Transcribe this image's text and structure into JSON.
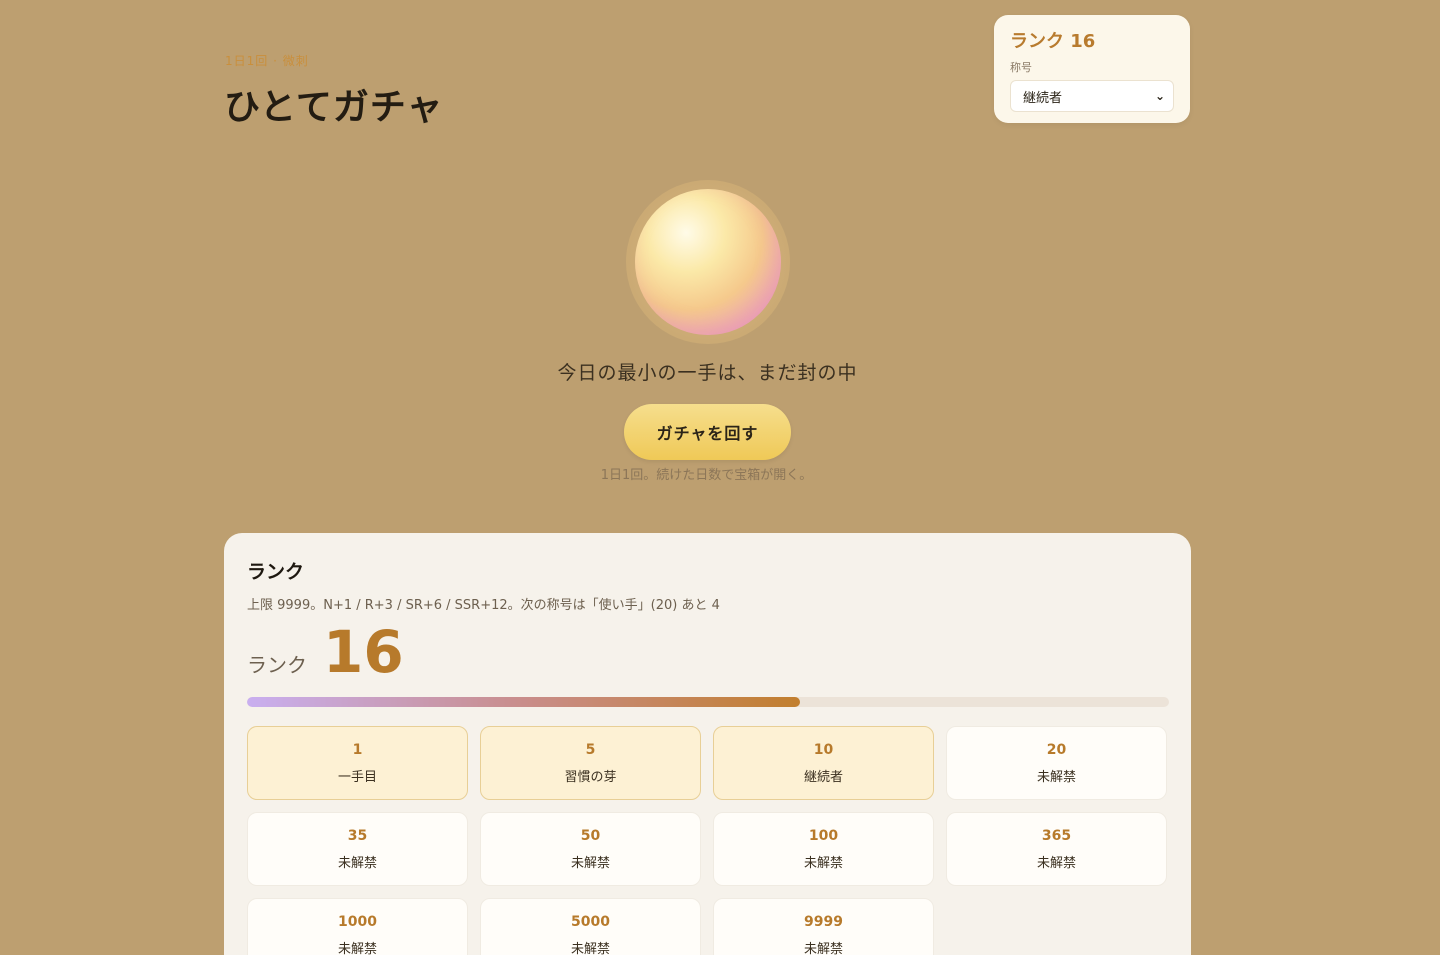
{
  "header": {
    "eyebrow": "1日1回 · 微刺",
    "title": "ひとてガチャ"
  },
  "rank_card": {
    "rank_title": "ランク 16",
    "title_label": "称号",
    "selected_title": "継続者"
  },
  "gacha": {
    "sealed_text": "今日の最小の一手は、まだ封の中",
    "spin_label": "ガチャを回す",
    "hint": "1日1回。続けた日数で宝箱が開く。"
  },
  "rank_panel": {
    "heading": "ランク",
    "description": "上限 9999。N+1 / R+3 / SR+6 / SSR+12。次の称号は「使い手」(20) あと 4",
    "rank_label": "ランク",
    "rank_value": "16",
    "progress_fraction": 0.6
  },
  "milestones": [
    {
      "level": "1",
      "name": "一手目",
      "unlocked": true
    },
    {
      "level": "5",
      "name": "習慣の芽",
      "unlocked": true
    },
    {
      "level": "10",
      "name": "継続者",
      "unlocked": true
    },
    {
      "level": "20",
      "name": "未解禁",
      "unlocked": false
    },
    {
      "level": "35",
      "name": "未解禁",
      "unlocked": false
    },
    {
      "level": "50",
      "name": "未解禁",
      "unlocked": false
    },
    {
      "level": "100",
      "name": "未解禁",
      "unlocked": false
    },
    {
      "level": "365",
      "name": "未解禁",
      "unlocked": false
    },
    {
      "level": "1000",
      "name": "未解禁",
      "unlocked": false
    },
    {
      "level": "5000",
      "name": "未解禁",
      "unlocked": false
    },
    {
      "level": "9999",
      "name": "未解禁",
      "unlocked": false
    }
  ],
  "colors": {
    "background": "#bd9f70",
    "accent": "#b77a2b",
    "button": "#efc957"
  }
}
